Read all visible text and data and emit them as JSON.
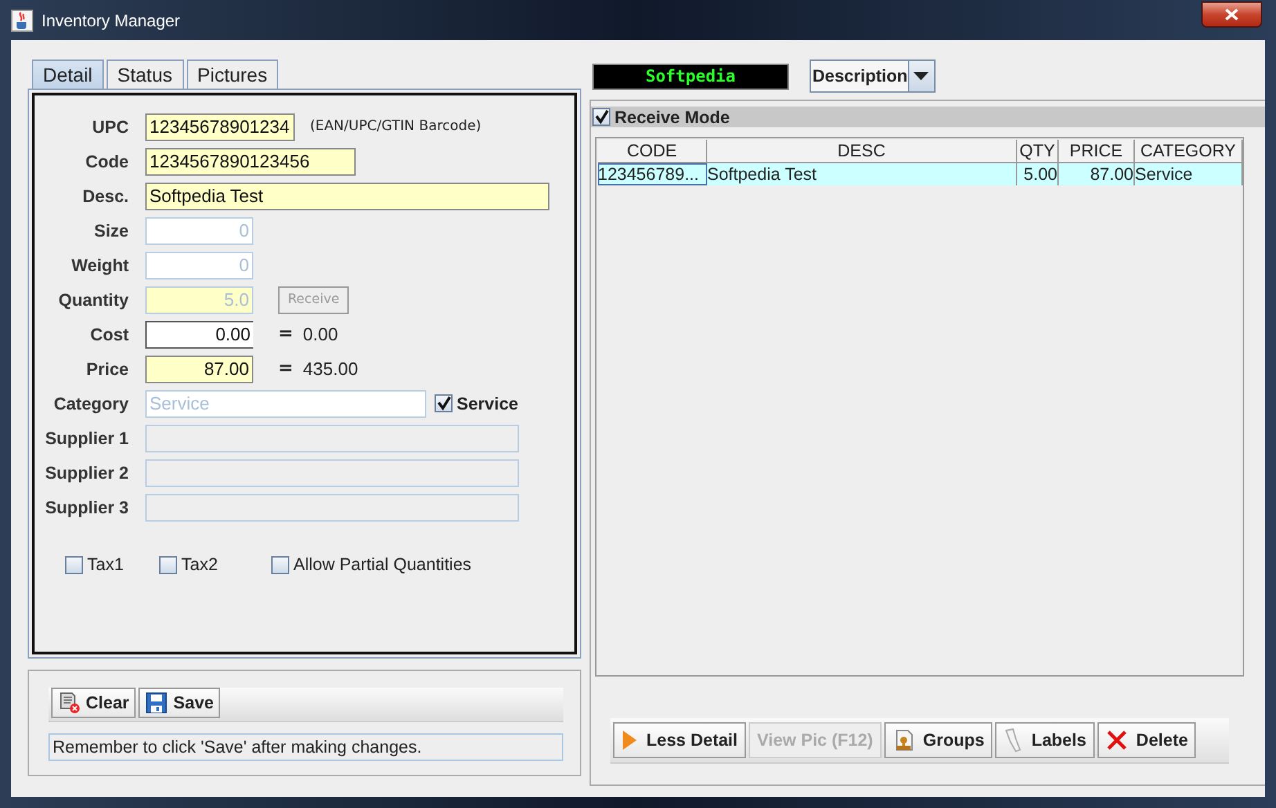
{
  "window": {
    "title": "Inventory Manager"
  },
  "tabs": [
    {
      "label": "Detail",
      "selected": true
    },
    {
      "label": "Status",
      "selected": false
    },
    {
      "label": "Pictures",
      "selected": false
    }
  ],
  "form": {
    "fields": [
      {
        "label": "UPC",
        "value": "12345678901234",
        "kind": "text",
        "highlighted": true,
        "disabled": false,
        "note": "(EAN/UPC/GTIN Barcode)"
      },
      {
        "label": "Code",
        "value": "1234567890123456",
        "kind": "text",
        "highlighted": true,
        "disabled": false
      },
      {
        "label": "Desc.",
        "value": "Softpedia Test",
        "kind": "text",
        "highlighted": true,
        "disabled": false
      },
      {
        "label": "Size",
        "value": "0",
        "kind": "number",
        "highlighted": false,
        "disabled": true
      },
      {
        "label": "Weight",
        "value": "0",
        "kind": "number",
        "highlighted": false,
        "disabled": true
      },
      {
        "label": "Quantity",
        "value": "5.0",
        "kind": "number",
        "highlighted": true,
        "disabled": true,
        "button": {
          "label": "Receive",
          "disabled": true
        }
      },
      {
        "label": "Cost",
        "value": "0.00",
        "kind": "number",
        "highlighted": false,
        "disabled": false,
        "total": {
          "sign": "=",
          "value": "0.00"
        }
      },
      {
        "label": "Price",
        "value": "87.00",
        "kind": "number",
        "highlighted": true,
        "disabled": false,
        "total": {
          "sign": "=",
          "value": "435.00"
        }
      },
      {
        "label": "Category",
        "value": "Service",
        "kind": "text",
        "highlighted": false,
        "disabled": true,
        "checkbox": {
          "label": "Service",
          "checked": true
        }
      },
      {
        "label": "Supplier 1",
        "kind": "text",
        "highlighted": false,
        "disabled": true
      },
      {
        "label": "Supplier 2",
        "kind": "text",
        "highlighted": false,
        "disabled": true
      },
      {
        "label": "Supplier 3",
        "kind": "text",
        "highlighted": false,
        "disabled": true
      }
    ],
    "checkboxes": [
      {
        "label": "Tax1",
        "checked": false
      },
      {
        "label": "Tax2",
        "checked": false
      },
      {
        "label": "Allow Partial Quantities",
        "checked": false
      }
    ]
  },
  "edit_toolbar": {
    "buttons": [
      {
        "label": "Clear"
      },
      {
        "label": "Save"
      }
    ],
    "message": "Remember to click 'Save' after making changes."
  },
  "display": {
    "text": "Softpedia"
  },
  "sort_dropdown": {
    "value": "Description"
  },
  "receive_mode": {
    "label": "Receive Mode",
    "checked": true
  },
  "table": {
    "columns": [
      "CODE",
      "DESC",
      "QTY",
      "PRICE",
      "CATEGORY"
    ],
    "rows": [
      {
        "cells": [
          "123456789...",
          "Softpedia Test",
          "5.00",
          "87.00",
          "Service"
        ],
        "selected": true
      }
    ]
  },
  "item_toolbar": {
    "buttons": [
      {
        "label": "Less Detail",
        "disabled": false
      },
      {
        "label": "View Pic (F12)",
        "disabled": true
      },
      {
        "label": "Groups",
        "disabled": false
      },
      {
        "label": "Labels",
        "disabled": false
      },
      {
        "label": "Delete",
        "disabled": false
      }
    ]
  }
}
